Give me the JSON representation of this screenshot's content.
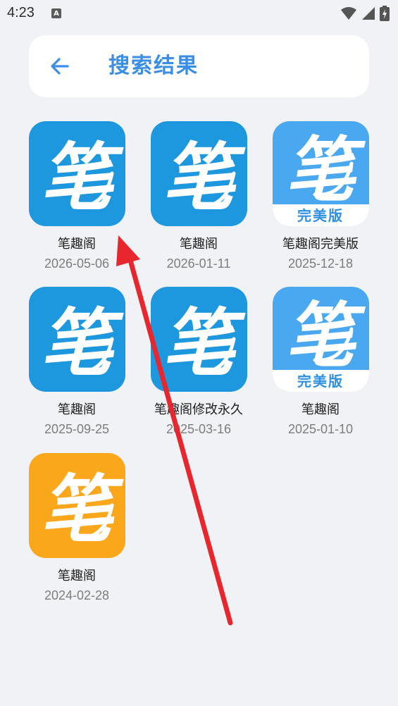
{
  "status_bar": {
    "time": "4:23",
    "notification_icon": "a-letter-icon",
    "icons": [
      "wifi-icon",
      "signal-icon",
      "battery-charging-icon"
    ]
  },
  "header": {
    "back_icon": "arrow-left-icon",
    "title": "搜索结果"
  },
  "results": [
    {
      "name": "笔趣阁",
      "date": "2026-05-06",
      "icon_glyph": "笔",
      "badge": "",
      "bg": "#1d97de"
    },
    {
      "name": "笔趣阁",
      "date": "2026-01-11",
      "icon_glyph": "笔",
      "badge": "",
      "bg": "#1d97de"
    },
    {
      "name": "笔趣阁完美版",
      "date": "2025-12-18",
      "icon_glyph": "笔",
      "badge": "完美版",
      "bg": "#4aa8f0"
    },
    {
      "name": "笔趣阁",
      "date": "2025-09-25",
      "icon_glyph": "笔",
      "badge": "",
      "bg": "#1d97de"
    },
    {
      "name": "笔趣阁修改永久",
      "date": "2025-03-16",
      "icon_glyph": "笔",
      "badge": "",
      "bg": "#1d97de"
    },
    {
      "name": "笔趣阁",
      "date": "2025-01-10",
      "icon_glyph": "笔",
      "badge": "完美版",
      "bg": "#4aa8f0"
    },
    {
      "name": "笔趣阁",
      "date": "2024-02-28",
      "icon_glyph": "笔",
      "badge": "",
      "bg": "#fba71c"
    }
  ],
  "colors": {
    "accent": "#3a8ee6",
    "annotation_arrow": "#e8262d"
  }
}
